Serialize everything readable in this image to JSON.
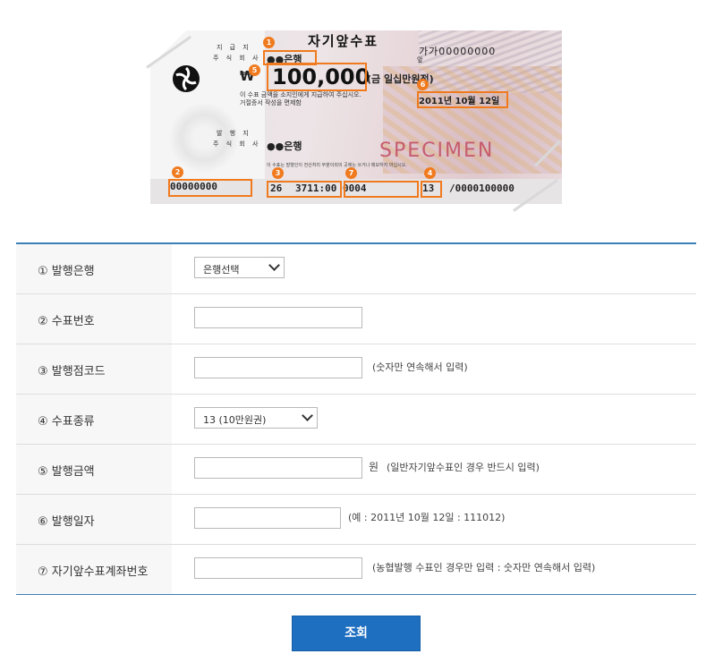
{
  "cheque": {
    "title": "자기앞수표",
    "serial_label": "가가",
    "serial": "00000000",
    "serial_sub": "앞",
    "stub_top": [
      "지 급 지",
      "주 식 회 사"
    ],
    "stub_bottom": [
      "발 행 지",
      "주 식 회 사"
    ],
    "bank_top": "●●은행",
    "currency": "₩",
    "amount": "100,000",
    "amount_korean": "(금 일십만원정)",
    "note_lines": [
      "이 수표 금액을 소지인에게 지급하여 주십시오.",
      "거절증서 작성을 면제함"
    ],
    "date": "2011년 10월 12일",
    "bank_bottom": "●●은행",
    "fine_print": "이 수표는 발행인이 전산처리 부분이외의 곳에는 쓰거나 메모하지 마십시오.",
    "specimen": "SPECIMEN",
    "micr": {
      "cheque_no": "00000000",
      "branch": "26",
      "branch_code": "3711:00 0004",
      "type": "13",
      "account": "/0000100000"
    },
    "markers": [
      "1",
      "2",
      "3",
      "4",
      "5",
      "6",
      "7"
    ],
    "accent_color": "#f07a1e"
  },
  "form": {
    "rows": [
      {
        "label": "① 발행은행",
        "kind": "select",
        "value": "은행선택"
      },
      {
        "label": "② 수표번호",
        "kind": "input",
        "value": ""
      },
      {
        "label": "③ 발행점코드",
        "kind": "input",
        "value": "",
        "hint": "(숫자만 연속해서 입력)"
      },
      {
        "label": "④ 수표종류",
        "kind": "select",
        "value": "13 (10만원권)"
      },
      {
        "label": "⑤ 발행금액",
        "kind": "input",
        "value": "",
        "suffix": "원",
        "hint": "(일반자기앞수표인 경우 반드시 입력)"
      },
      {
        "label": "⑥ 발행일자",
        "kind": "input",
        "value": "",
        "hint": "(예 : 2011년 10월 12일 : 111012)"
      },
      {
        "label": "⑦ 자기앞수표계좌번호",
        "kind": "input",
        "value": "",
        "hint": "(농협발행 수표인 경우만 입력 : 숫자만 연속해서 입력)"
      }
    ]
  },
  "submit_label": "조회",
  "colors": {
    "primary": "#1f6fc0",
    "table_border": "#3c7fb5",
    "label_bg": "#f7f7f7"
  }
}
